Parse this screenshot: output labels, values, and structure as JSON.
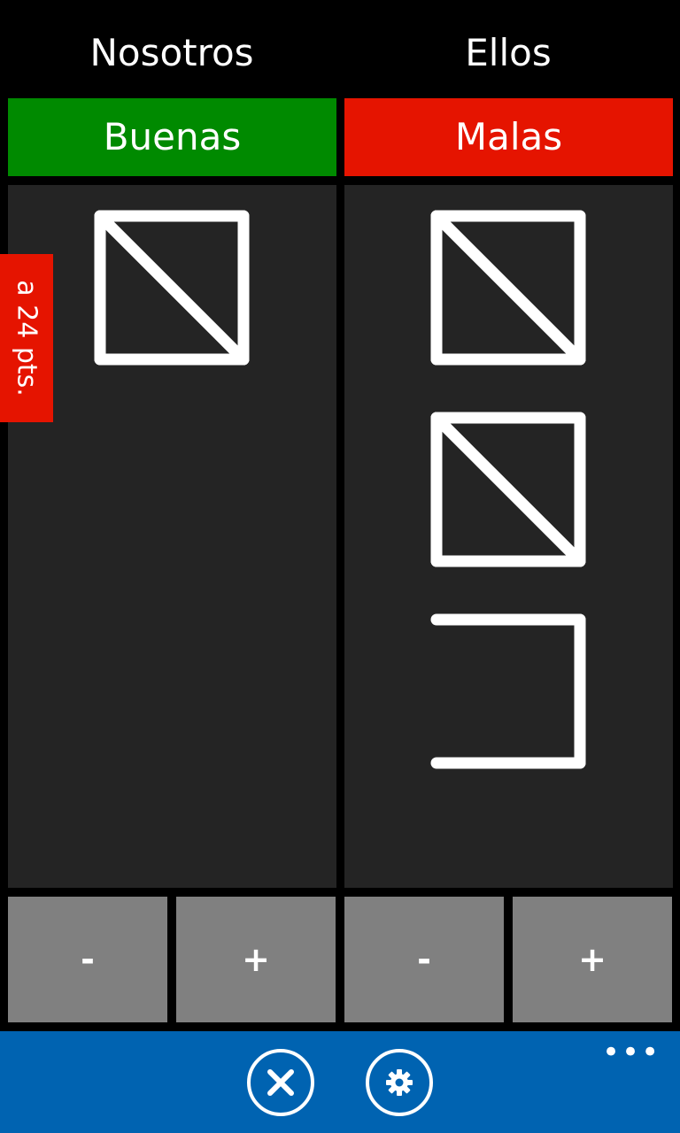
{
  "teams": {
    "left": {
      "name": "Nosotros",
      "status": "Buenas",
      "status_color": "#008a00",
      "step": 5
    },
    "right": {
      "name": "Ellos",
      "status": "Malas",
      "status_color": "#e51400",
      "step": 13
    }
  },
  "controls": {
    "minus_label": "-",
    "plus_label": "+"
  },
  "goal_tab": {
    "label": "a 24 pts.",
    "color": "#e51400"
  },
  "app_bar": {
    "color": "#0063b1",
    "close_icon": "close-icon",
    "settings_icon": "gear-icon",
    "more_label": "•••"
  }
}
